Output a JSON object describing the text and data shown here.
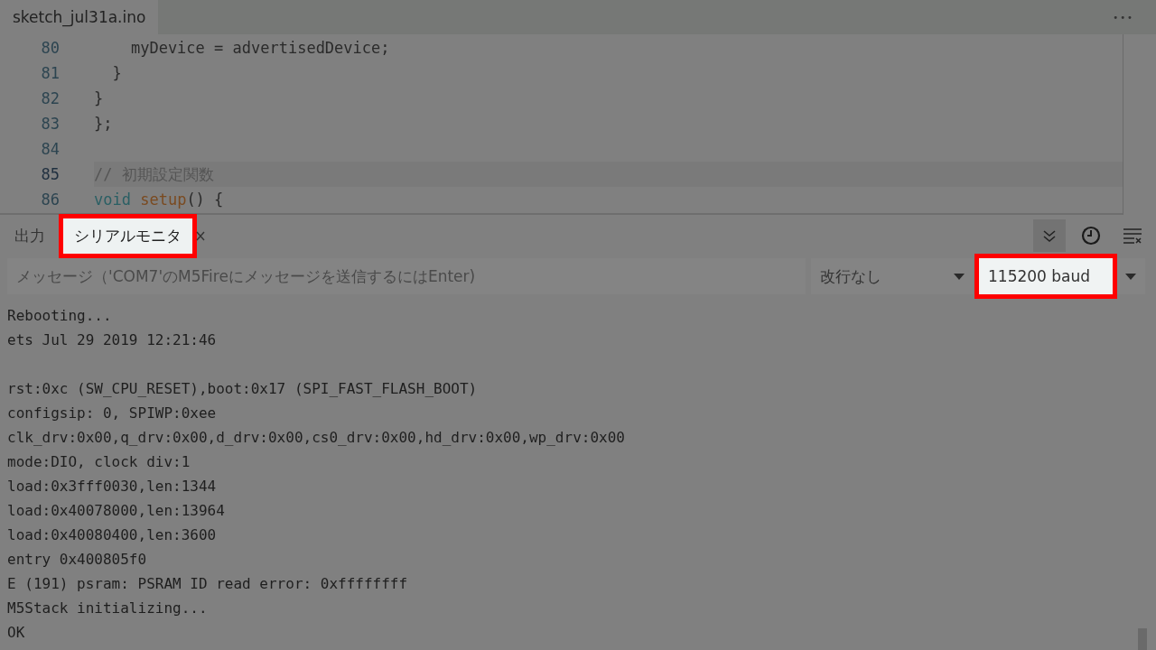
{
  "file_tab": {
    "label": "sketch_jul31a.ino"
  },
  "more_label": "•••",
  "editor": {
    "lines": [
      {
        "number": "80",
        "current": false,
        "tokens": [
          {
            "text": "    myDevice = advertisedDevice;",
            "kind": "plain"
          }
        ]
      },
      {
        "number": "81",
        "current": false,
        "tokens": [
          {
            "text": "  }",
            "kind": "plain"
          }
        ]
      },
      {
        "number": "82",
        "current": false,
        "tokens": [
          {
            "text": "}",
            "kind": "plain"
          }
        ]
      },
      {
        "number": "83",
        "current": false,
        "tokens": [
          {
            "text": "};",
            "kind": "plain"
          }
        ]
      },
      {
        "number": "84",
        "current": false
      },
      {
        "number": "85",
        "current": true,
        "tokens": [
          {
            "text": "// 初期設定関数",
            "kind": "comment"
          }
        ]
      },
      {
        "number": "86",
        "current": false,
        "tokens": [
          {
            "text": "void",
            "kind": "keyword"
          },
          {
            "text": "setup",
            "kind": "function",
            "space_before": true
          },
          {
            "text": "() {",
            "kind": "plain"
          }
        ]
      }
    ]
  },
  "panel_tabs": [
    {
      "label": "出力",
      "selected": false,
      "highlighted": false
    },
    {
      "label": "シリアルモニタ",
      "selected": true,
      "highlighted": true
    }
  ],
  "message_field": {
    "placeholder": "メッセージ（'COM7'のM5Fireにメッセージを送信するにはEnter)"
  },
  "line_ending": {
    "value": "改行なし",
    "highlighted": false
  },
  "baud": {
    "value": "115200 baud",
    "highlighted": true
  },
  "output": [
    {
      "kind": "text",
      "text": "Rebooting..."
    },
    {
      "kind": "text",
      "text": "ets Jul 29 2019 12:21:46"
    },
    {
      "kind": "blank"
    },
    {
      "kind": "text",
      "text": "rst:0xc (SW_CPU_RESET),boot:0x17 (SPI_FAST_FLASH_BOOT)"
    },
    {
      "kind": "text",
      "text": "configsip: 0, SPIWP:0xee"
    },
    {
      "kind": "text",
      "text": "clk_drv:0x00,q_drv:0x00,d_drv:0x00,cs0_drv:0x00,hd_drv:0x00,wp_drv:0x00"
    },
    {
      "kind": "text",
      "text": "mode:DIO, clock div:1"
    },
    {
      "kind": "text",
      "text": "load:0x3fff0030,len:1344"
    },
    {
      "kind": "text",
      "text": "load:0x40078000,len:13964"
    },
    {
      "kind": "text",
      "text": "load:0x40080400,len:3600"
    },
    {
      "kind": "text",
      "text": "entry 0x400805f0"
    },
    {
      "kind": "text",
      "text": "E (191) psram: PSRAM ID read error: 0xffffffff"
    },
    {
      "kind": "text",
      "text": "M5Stack initializing..."
    },
    {
      "kind": "text",
      "text": "OK"
    }
  ]
}
